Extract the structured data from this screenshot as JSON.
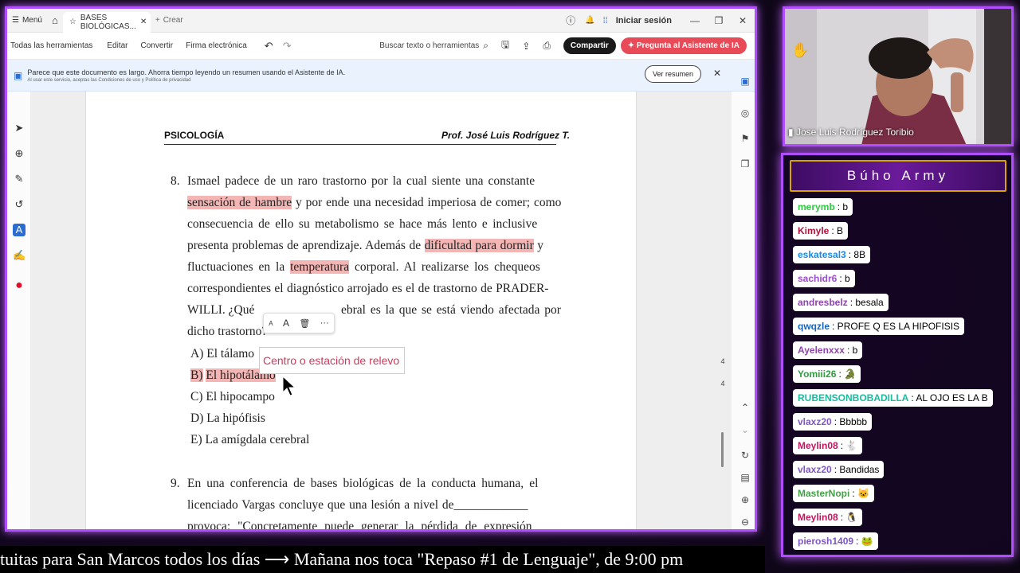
{
  "browser": {
    "menu_label": "Menú",
    "tab_title": "BASES BIOLÓGICAS...",
    "new_tab_label": "Crear",
    "signin_label": "Iniciar sesión"
  },
  "toolbar": {
    "all_tools": "Todas las herramientas",
    "edit": "Editar",
    "convert": "Convertir",
    "esign": "Firma electrónica",
    "search": "Buscar texto o herramientas",
    "share": "Compartir",
    "ask_ai": "Pregunta al Asistente de IA"
  },
  "banner": {
    "text": "Parece que este documento es largo. Ahorra tiempo leyendo un resumen usando el Asistente de IA.",
    "subtext": "Al usar este servicio, aceptas las Condiciones de uso y Política de privacidad",
    "button": "Ver resumen"
  },
  "document": {
    "subject": "PSICOLOGÍA",
    "teacher": "Prof. José Luis Rodríguez T.",
    "q8": {
      "number": "8.",
      "lines": [
        [
          "Ismael padece de un raro trastorno por la cual siente una constante"
        ],
        [
          "",
          "sensación de hambre",
          " y por ende una necesidad imperiosa de comer; como"
        ],
        [
          "consecuencia de ello su metabolismo se hace más lento e inclusive"
        ],
        [
          "presenta problemas de aprendizaje. Además de ",
          "dificultad para dormir",
          " y"
        ],
        [
          "fluctuaciones en la ",
          "temperatura",
          " corporal. Al realizarse los chequeos"
        ],
        [
          "correspondientes el diagnóstico arrojado es el de trastorno de PRADER-"
        ],
        [
          "WILLI. ¿Qué",
          "",
          "ebral es la que se está viendo afectada por"
        ],
        [
          "dicho trastorno?"
        ]
      ],
      "options": [
        {
          "letter": "A)",
          "text": "El tálamo"
        },
        {
          "letter": "B)",
          "text": "El hipotálamo"
        },
        {
          "letter": "C)",
          "text": "El hipocampo"
        },
        {
          "letter": "D)",
          "text": "La hipófisis"
        },
        {
          "letter": "E)",
          "text": "La amígdala cerebral"
        }
      ]
    },
    "comment_text": "Centro o estación de  relevo",
    "q9": {
      "number": "9.",
      "line1": "En una conferencia de bases biológicas de la conducta humana, el",
      "line2": "licenciado Vargas concluye que una lesión a nivel de____________",
      "line3": "provoca: \"Concretamente puede generar la pérdida de expresión"
    },
    "page_numbers": [
      "4",
      "4"
    ]
  },
  "webcam": {
    "name": "Jose Luis Rodríguez Toribio"
  },
  "chat": {
    "title": "Búho Army",
    "messages": [
      {
        "user": "merymb",
        "text": ": b",
        "color": "#2ecc40"
      },
      {
        "user": "Kimyle",
        "text": ": B",
        "color": "#b0123a"
      },
      {
        "user": "eskatesal3",
        "text": ": 8B",
        "color": "#1e88e5"
      },
      {
        "user": "sachidr6",
        "text": ": b",
        "color": "#9c4dcc"
      },
      {
        "user": "andresbelz",
        "text": ": besala",
        "color": "#8e44ad"
      },
      {
        "user": "qwqzle",
        "text": ": PROFE Q ES LA HIPOFISIS",
        "color": "#1565c0"
      },
      {
        "user": "Ayelenxxx",
        "text": ": b",
        "color": "#8e44ad"
      },
      {
        "user": "Yomiii26",
        "text": ": 🐊",
        "color": "#2e9e3e"
      },
      {
        "user": "RUBENSONBOBADILLA",
        "text": ": AL OJO ES LA B",
        "color": "#1abc9c"
      },
      {
        "user": "vlaxz20",
        "text": ": Bbbbb",
        "color": "#7e57c2"
      },
      {
        "user": "Meylin08",
        "text": ": 🐇",
        "color": "#c2185b"
      },
      {
        "user": "vlaxz20",
        "text": ": Bandidas",
        "color": "#7e57c2"
      },
      {
        "user": "MasterNopi",
        "text": ": 🐱",
        "color": "#43a047"
      },
      {
        "user": "Meylin08",
        "text": ": 🐧",
        "color": "#c2185b"
      },
      {
        "user": "pierosh1409",
        "text": ": 🐸",
        "color": "#7e57c2"
      }
    ]
  },
  "ticker": {
    "text": "tuitas para San Marcos todos los días  ⟶  Mañana nos toca \"Repaso #1 de Lenguaje\", de 9:00 pm"
  }
}
